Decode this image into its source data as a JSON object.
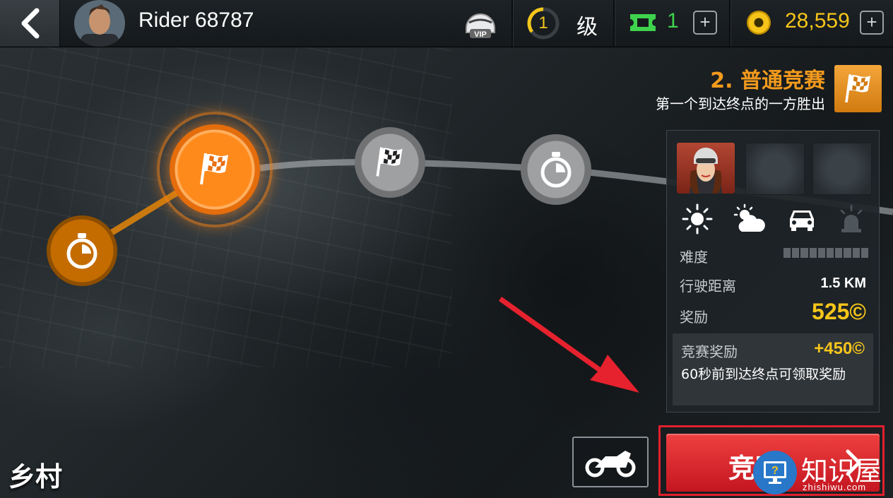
{
  "header": {
    "player_name": "Rider 68787",
    "level_value": "1",
    "level_label": "级",
    "tickets": "1",
    "coins": "28,559",
    "vip_label": "VIP"
  },
  "race": {
    "title": "2. 普通竞赛",
    "subtitle": "第一个到达终点的一方胜出"
  },
  "panel": {
    "difficulty_label": "难度",
    "difficulty_level": 0,
    "difficulty_segments": 10,
    "distance_label": "行驶距离",
    "distance_value": "1.5 KM",
    "reward_label": "奖励",
    "reward_value": "525©",
    "bonus_label": "竞赛奖励",
    "bonus_value": "+450©",
    "bonus_desc": "60秒前到达终点可领取奖励",
    "conditions": [
      "sun-icon",
      "partly-cloudy-icon",
      "car-traffic-icon",
      "police-light-icon"
    ]
  },
  "map": {
    "region": "乡村",
    "nodes": [
      {
        "type": "time-trial",
        "state": "completed"
      },
      {
        "type": "race",
        "state": "selected"
      },
      {
        "type": "race",
        "state": "locked"
      },
      {
        "type": "time-trial",
        "state": "locked"
      }
    ]
  },
  "footer": {
    "race_button_label": "竞赛"
  },
  "watermark": {
    "text": "知识屋",
    "url": "zhishiwu.com"
  },
  "colors": {
    "accent_orange": "#f29a1d",
    "coin_yellow": "#f6c51a",
    "ticket_green": "#3ed24d",
    "race_red": "#e1202e"
  }
}
